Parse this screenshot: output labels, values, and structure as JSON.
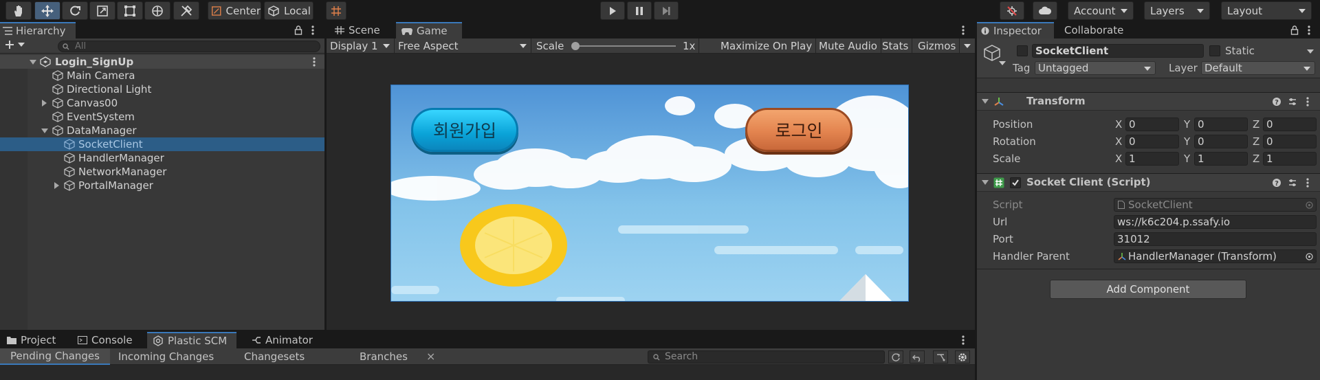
{
  "toolbar": {
    "center_label": "Center",
    "local_label": "Local",
    "account_label": "Account",
    "layers_label": "Layers",
    "layout_label": "Layout"
  },
  "hierarchy": {
    "tab_label": "Hierarchy",
    "search_placeholder": "All",
    "scene_name": "Login_SignUp",
    "items": [
      {
        "label": "Main Camera"
      },
      {
        "label": "Directional Light"
      },
      {
        "label": "Canvas00"
      },
      {
        "label": "EventSystem"
      },
      {
        "label": "DataManager"
      },
      {
        "label": "SocketClient"
      },
      {
        "label": "HandlerManager"
      },
      {
        "label": "NetworkManager"
      },
      {
        "label": "PortalManager"
      }
    ]
  },
  "view": {
    "tabs": [
      "Scene",
      "Game"
    ],
    "display": "Display 1",
    "aspect": "Free Aspect",
    "scale_label": "Scale",
    "scale_value": "1x",
    "maximize": "Maximize On Play",
    "mute": "Mute Audio",
    "stats": "Stats",
    "gizmos": "Gizmos"
  },
  "game": {
    "signup_label": "회원가입",
    "login_label": "로그인"
  },
  "bottom": {
    "tabs": [
      "Project",
      "Console",
      "Plastic SCM",
      "Animator"
    ],
    "subtabs": [
      "Pending Changes",
      "Incoming Changes",
      "Changesets",
      "Branches"
    ],
    "close_glyph": "×",
    "search_placeholder": "Search"
  },
  "inspector": {
    "tabs": [
      "Inspector",
      "Collaborate"
    ],
    "object_name": "SocketClient",
    "static_label": "Static",
    "tag_label": "Tag",
    "tag_value": "Untagged",
    "layer_label": "Layer",
    "layer_value": "Default",
    "transform": {
      "title": "Transform",
      "rows": [
        {
          "label": "Position",
          "x": "0",
          "y": "0",
          "z": "0"
        },
        {
          "label": "Rotation",
          "x": "0",
          "y": "0",
          "z": "0"
        },
        {
          "label": "Scale",
          "x": "1",
          "y": "1",
          "z": "1"
        }
      ],
      "axis": [
        "X",
        "Y",
        "Z"
      ]
    },
    "script_component": {
      "title": "Socket Client (Script)",
      "script_label": "Script",
      "script_value": "SocketClient",
      "url_label": "Url",
      "url_value": "ws://k6c204.p.ssafy.io",
      "port_label": "Port",
      "port_value": "31012",
      "handler_label": "Handler Parent",
      "handler_value": "HandlerManager (Transform)"
    },
    "add_component": "Add Component"
  },
  "colors": {
    "selection": "#2c5d87",
    "accent": "#3a79bb",
    "sky": "#86c5ea"
  }
}
